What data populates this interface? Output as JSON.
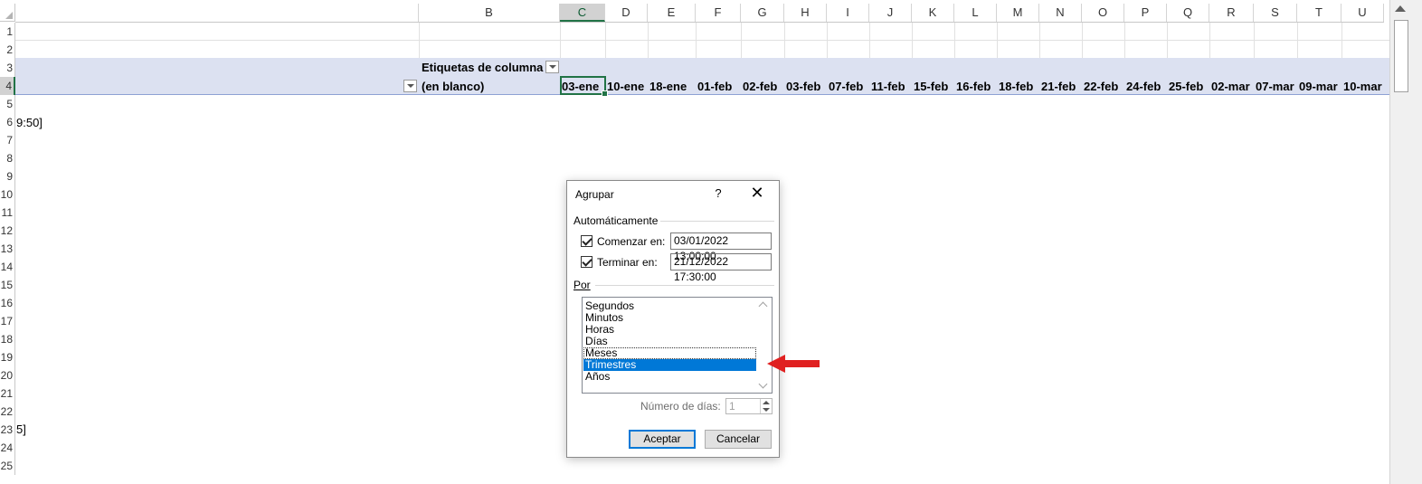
{
  "column_headers": [
    "B",
    "C",
    "D",
    "E",
    "F",
    "G",
    "H",
    "I",
    "J",
    "K",
    "L",
    "M",
    "N",
    "O",
    "P",
    "Q",
    "R",
    "S",
    "T",
    "U"
  ],
  "row_headers": [
    "1",
    "2",
    "3",
    "4",
    "5",
    "6",
    "7",
    "8",
    "9",
    "10",
    "11",
    "12",
    "13",
    "14",
    "15",
    "16",
    "17",
    "18",
    "19",
    "20",
    "21",
    "22",
    "23",
    "24",
    "25"
  ],
  "pivot": {
    "col_labels_caption": "Etiquetas de columna",
    "blank_label": "(en blanco)",
    "dates": [
      "03-ene",
      "10-ene",
      "18-ene",
      "01-feb",
      "02-feb",
      "03-feb",
      "07-feb",
      "11-feb",
      "15-feb",
      "16-feb",
      "18-feb",
      "21-feb",
      "22-feb",
      "24-feb",
      "25-feb",
      "02-mar",
      "07-mar",
      "09-mar",
      "10-mar"
    ]
  },
  "clipped_cells": {
    "row6": "9:50]",
    "row23": "5]"
  },
  "dialog": {
    "title": "Agrupar",
    "help_glyph": "?",
    "close_glyph": "✕",
    "auto_section": "Automáticamente",
    "start_label": "Comenzar en:",
    "start_value": "03/01/2022 13:00:00",
    "end_label": "Terminar en:",
    "end_value": "21/12/2022 17:30:00",
    "by_section": "Por",
    "list_items": [
      "Segundos",
      "Minutos",
      "Horas",
      "Días",
      "Meses",
      "Trimestres",
      "Años"
    ],
    "selected_index": 5,
    "focused_index": 4,
    "days_label": "Número de días:",
    "days_value": "1",
    "ok_label": "Aceptar",
    "cancel_label": "Cancelar"
  },
  "colors": {
    "selection_green": "#217346",
    "pivot_band": "#dce1f1",
    "list_highlight": "#0078d7",
    "annotation_arrow": "#e02020"
  },
  "icons": [
    "dropdown-filter-icon",
    "help-icon",
    "close-icon",
    "checkbox-checked-icon",
    "spin-up-icon",
    "spin-down-icon",
    "red-arrow-annotation"
  ]
}
